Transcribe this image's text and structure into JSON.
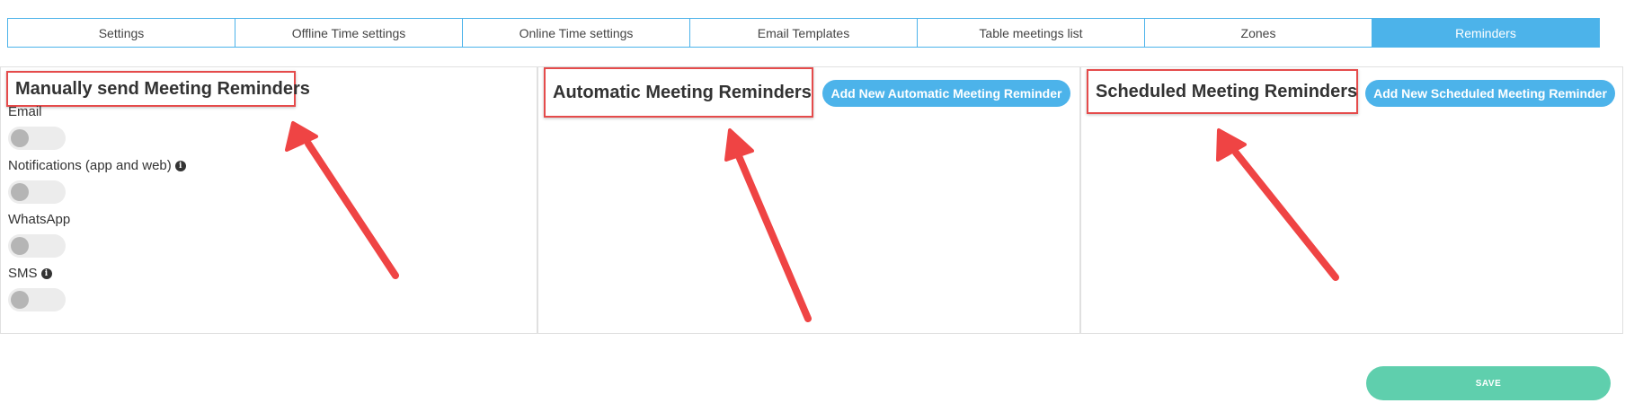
{
  "tabs": [
    {
      "label": "Settings",
      "active": false
    },
    {
      "label": "Offline Time settings",
      "active": false
    },
    {
      "label": "Online Time settings",
      "active": false
    },
    {
      "label": "Email Templates",
      "active": false
    },
    {
      "label": "Table meetings list",
      "active": false
    },
    {
      "label": "Zones",
      "active": false
    },
    {
      "label": "Reminders",
      "active": true
    }
  ],
  "manual": {
    "title": "Manually send Meeting Reminders",
    "options": [
      {
        "label": "Email",
        "enabled": false,
        "info": false
      },
      {
        "label": "Notifications (app and web)",
        "enabled": false,
        "info": true
      },
      {
        "label": "WhatsApp",
        "enabled": false,
        "info": false
      },
      {
        "label": "SMS",
        "enabled": false,
        "info": true
      }
    ]
  },
  "automatic": {
    "title": "Automatic Meeting Reminders",
    "add_button": "Add New Automatic Meeting Reminder"
  },
  "scheduled": {
    "title": "Scheduled Meeting Reminders",
    "add_button": "Add New Scheduled Meeting Reminder"
  },
  "save_label": "SAVE",
  "info_glyph": "i",
  "colors": {
    "accent": "#4cb3ea",
    "save": "#5fcfad",
    "highlight": "#e54b4b",
    "toggle_off": "#ececec"
  }
}
